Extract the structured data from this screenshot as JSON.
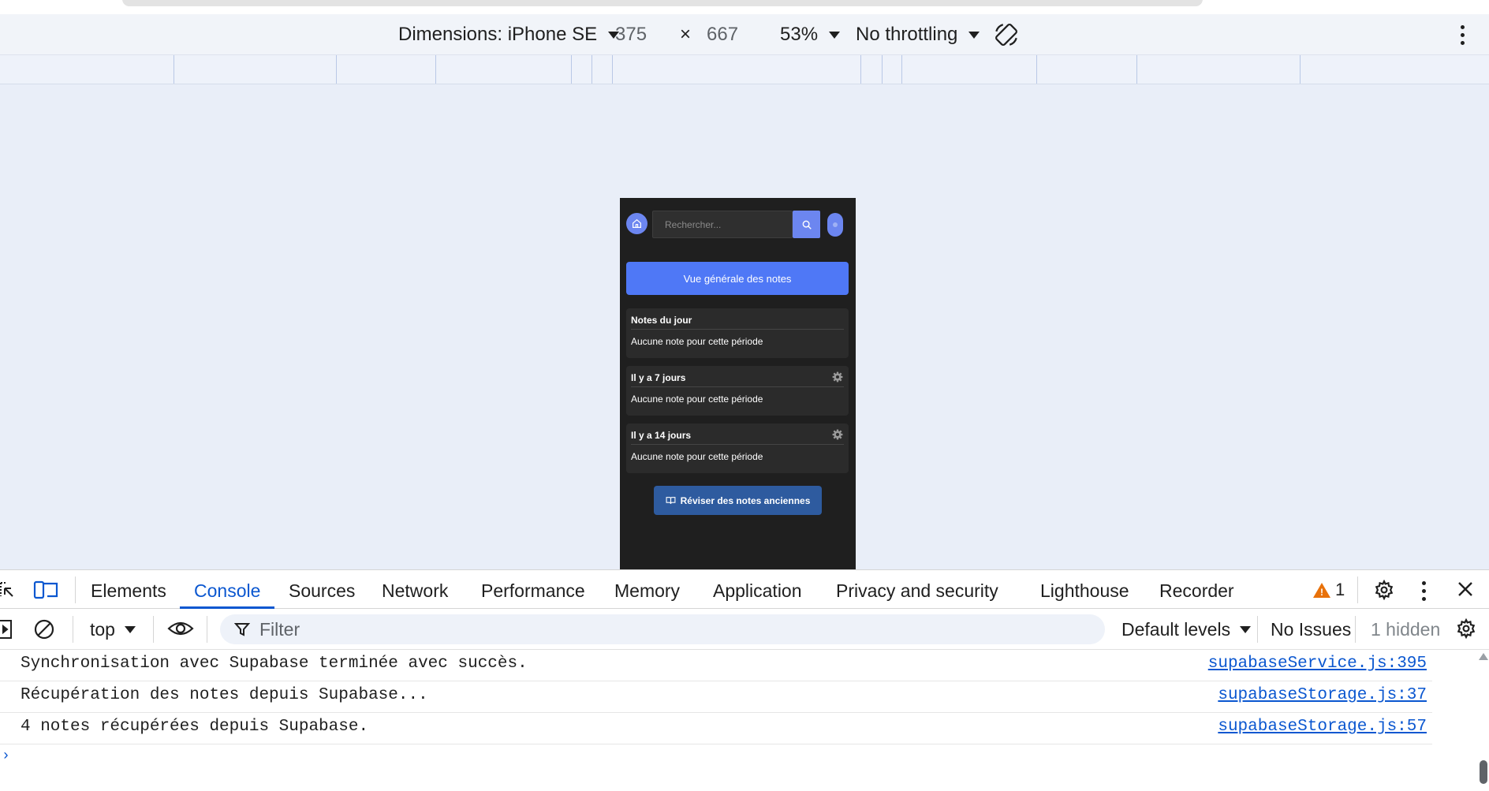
{
  "device_toolbar": {
    "dimensions_label": "Dimensions: iPhone SE",
    "width": "375",
    "times": "×",
    "height": "667",
    "zoom": "53%",
    "throttling": "No throttling"
  },
  "phone": {
    "search_placeholder": "Rechercher...",
    "overview_button": "Vue générale des notes",
    "cards": [
      {
        "title": "Notes du jour",
        "empty": "Aucune note pour cette période",
        "has_settings": false
      },
      {
        "title": "Il y a 7 jours",
        "empty": "Aucune note pour cette période",
        "has_settings": true
      },
      {
        "title": "Il y a 14 jours",
        "empty": "Aucune note pour cette période",
        "has_settings": true
      }
    ],
    "review_button": "Réviser des notes anciennes",
    "fab": "+"
  },
  "devtools": {
    "tabs": [
      "Elements",
      "Console",
      "Sources",
      "Network",
      "Performance",
      "Memory",
      "Application",
      "Privacy and security",
      "Lighthouse",
      "Recorder"
    ],
    "active_tab": "Console",
    "warnings_count": "1",
    "context": "top",
    "filter_placeholder": "Filter",
    "levels": "Default levels",
    "issues": "No Issues",
    "hidden": "1 hidden"
  },
  "console": {
    "rows": [
      {
        "message": "Synchronisation avec Supabase terminée avec succès.",
        "source": "supabaseService.js:395"
      },
      {
        "message": "Récupération des notes depuis Supabase...",
        "source": "supabaseStorage.js:37"
      },
      {
        "message": "4 notes récupérées depuis Supabase.",
        "source": "supabaseStorage.js:57"
      }
    ],
    "prompt": "›"
  },
  "colors": {
    "accent": "#4f78f6",
    "phone_bg": "#1f1f1f",
    "devtools_active": "#0b57d0",
    "review_button": "#2e5b9f"
  }
}
